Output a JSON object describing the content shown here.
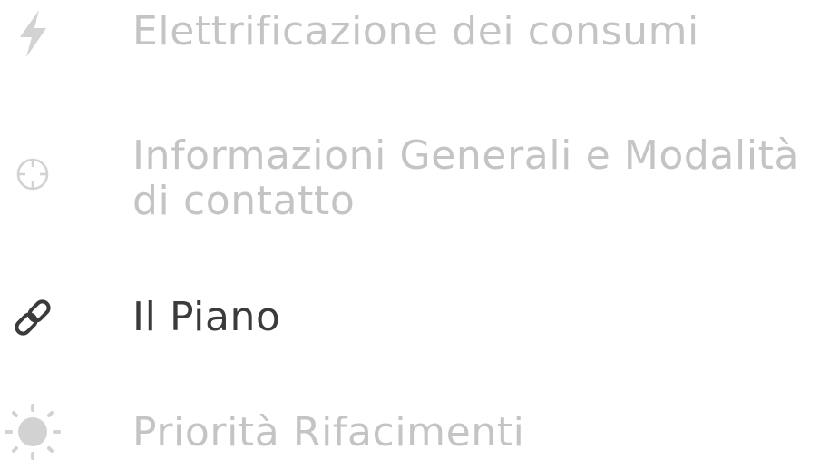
{
  "nav": {
    "items": [
      {
        "label": "Elettrificazione dei consumi",
        "icon": "lightning-bolt-icon",
        "active": false
      },
      {
        "label": "Informazioni Generali e Modalità di contatto",
        "icon": "crosshair-icon",
        "active": false
      },
      {
        "label": "Il Piano",
        "icon": "link-icon",
        "active": true
      },
      {
        "label": "Priorità Rifacimenti",
        "icon": "sun-icon",
        "active": false
      }
    ]
  },
  "colors": {
    "inactive_text": "#c4c4c4",
    "inactive_icon": "#d2d2d2",
    "active_text": "#3b3b3b",
    "active_icon": "#3b3b3b"
  }
}
